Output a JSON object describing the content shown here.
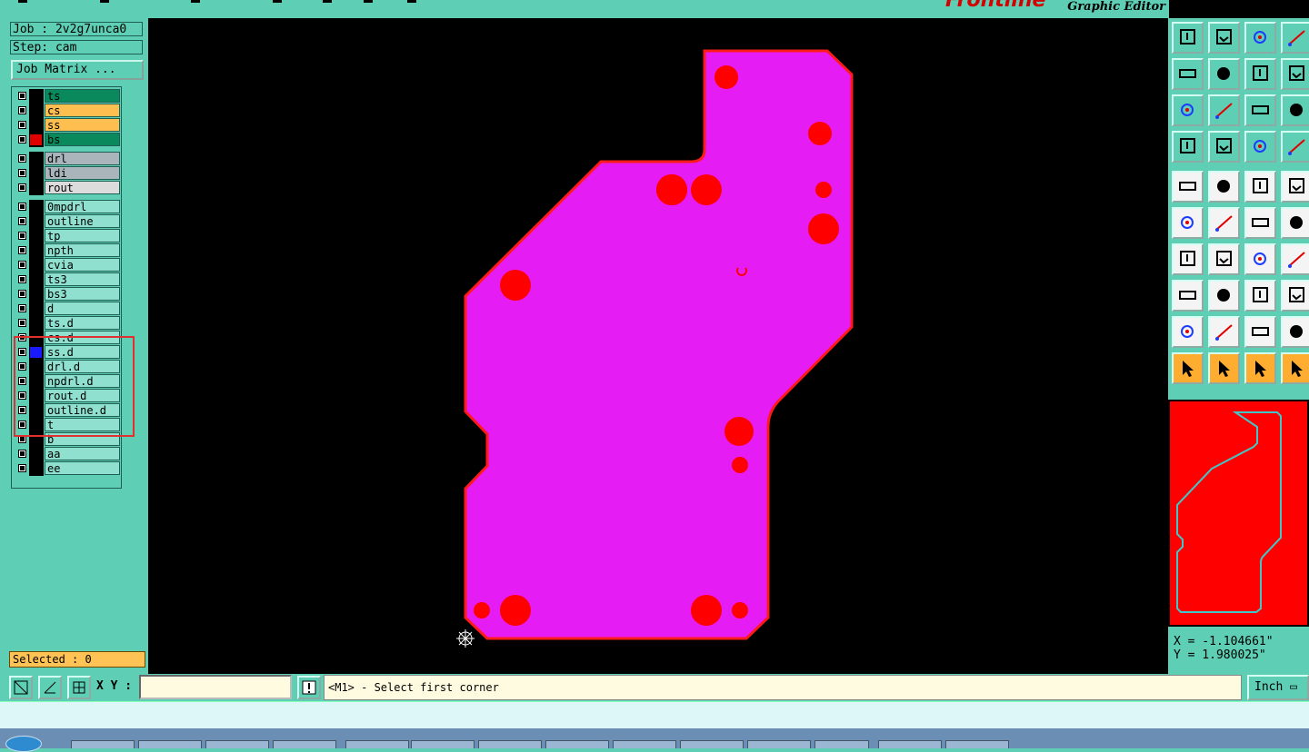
{
  "app": {
    "logo_text": "Frontline",
    "subtitle": "Graphic Editor"
  },
  "job": {
    "job_label": "Job : 2v2g7unca0",
    "step_label": "Step: cam",
    "matrix_button": "Job Matrix ..."
  },
  "layers": {
    "groups": [
      [
        {
          "name": "ts",
          "color": "#0a8a5c",
          "sw": "#000000"
        },
        {
          "name": "cs",
          "color": "#ffbe50",
          "sw": "#000000"
        },
        {
          "name": "ss",
          "color": "#ffbe50",
          "sw": "#000000"
        },
        {
          "name": "bs",
          "color": "#0a8a5c",
          "sw": "#e00000"
        }
      ],
      [
        {
          "name": "drl",
          "color": "#a9b5bb",
          "sw": "#000000"
        },
        {
          "name": "ldi",
          "color": "#a9b5bb",
          "sw": "#000000"
        },
        {
          "name": "rout",
          "color": "#dcdcdc",
          "sw": "#000000"
        }
      ],
      [
        {
          "name": "0mpdrl",
          "color": "#8fe0cf",
          "sw": "#000000"
        },
        {
          "name": "outline",
          "color": "#8fe0cf",
          "sw": "#000000"
        },
        {
          "name": "tp",
          "color": "#8fe0cf",
          "sw": "#000000"
        },
        {
          "name": "npth",
          "color": "#8fe0cf",
          "sw": "#000000"
        },
        {
          "name": "cvia",
          "color": "#8fe0cf",
          "sw": "#000000"
        },
        {
          "name": "ts3",
          "color": "#8fe0cf",
          "sw": "#000000"
        },
        {
          "name": "bs3",
          "color": "#8fe0cf",
          "sw": "#000000"
        },
        {
          "name": "d",
          "color": "#8fe0cf",
          "sw": "#000000"
        },
        {
          "name": "ts.d",
          "color": "#8fe0cf",
          "sw": "#000000"
        },
        {
          "name": "cs.d",
          "color": "#8fe0cf",
          "sw": "#000000"
        },
        {
          "name": "ss.d",
          "color": "#8fe0cf",
          "sw": "#1a1aff",
          "active": true
        },
        {
          "name": "drl.d",
          "color": "#8fe0cf",
          "sw": "#000000"
        },
        {
          "name": "npdrl.d",
          "color": "#8fe0cf",
          "sw": "#000000"
        },
        {
          "name": "rout.d",
          "color": "#8fe0cf",
          "sw": "#000000"
        },
        {
          "name": "outline.d",
          "color": "#8fe0cf",
          "sw": "#000000"
        },
        {
          "name": "t",
          "color": "#8fe0cf",
          "sw": "#000000"
        },
        {
          "name": "b",
          "color": "#8fe0cf",
          "sw": "#000000"
        },
        {
          "name": "aa",
          "color": "#8fe0cf",
          "sw": "#000000"
        },
        {
          "name": "ee",
          "color": "#8fe0cf",
          "sw": "#000000"
        }
      ]
    ]
  },
  "selection": {
    "label": "Selected : 0"
  },
  "canvas": {
    "board_fill": "#e61cf5",
    "board_outline": "#ff1a1a",
    "background": "#000000"
  },
  "coords": {
    "x_label": "X = -1.104661\"",
    "y_label": "Y = 1.980025\""
  },
  "bottom": {
    "xy_label": "X Y :",
    "xy_value": "",
    "prompt": "<M1> - Select first corner",
    "units": "Inch"
  },
  "colors": {
    "panel": "#5ecfb4",
    "accent_red": "#e00000",
    "highlight_orange": "#ffbe50"
  }
}
